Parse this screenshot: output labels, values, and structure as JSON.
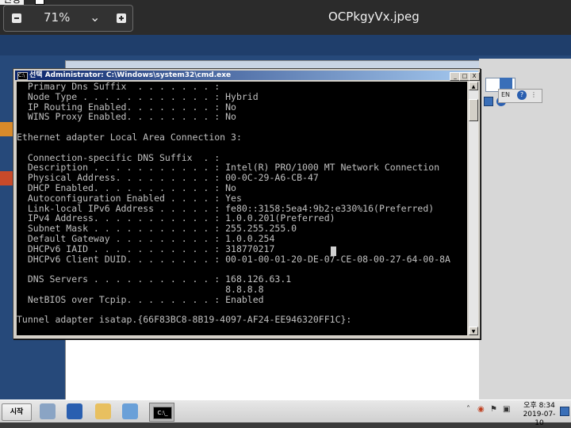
{
  "viewer": {
    "corner_label": "신청",
    "zoom": "71%",
    "filename": "OCPkgyVx.jpeg"
  },
  "cmd": {
    "title": "선택 Administrator: C:\\Windows\\system32\\cmd.exe",
    "minimize": "_",
    "maximize": "□",
    "close": "X",
    "lines": [
      "  Primary Dns Suffix  . . . . . . . :",
      "  Node Type . . . . . . . . . . . . : Hybrid",
      "  IP Routing Enabled. . . . . . . . : No",
      "  WINS Proxy Enabled. . . . . . . . : No",
      "",
      "Ethernet adapter Local Area Connection 3:",
      "",
      "  Connection-specific DNS Suffix  . :",
      "  Description . . . . . . . . . . . : Intel(R) PRO/1000 MT Network Connection",
      "  Physical Address. . . . . . . . . : 00-0C-29-A6-CB-47",
      "  DHCP Enabled. . . . . . . . . . . : No",
      "  Autoconfiguration Enabled . . . . : Yes",
      "  Link-local IPv6 Address . . . . . : fe80::3158:5ea4:9b2:e330%16(Preferred)",
      "  IPv4 Address. . . . . . . . . . . : 1.0.0.201(Preferred)",
      "  Subnet Mask . . . . . . . . . . . : 255.255.255.0",
      "  Default Gateway . . . . . . . . . : 1.0.0.254",
      "  DHCPv6 IAID . . . . . . . . . . . : 318770217",
      "  DHCPv6 Client DUID. . . . . . . . : 00-01-00-01-20-DE-07-CE-08-00-27-64-00-8A",
      "",
      "  DNS Servers . . . . . . . . . . . : 168.126.63.1",
      "                                      8.8.8.8",
      "  NetBIOS over Tcpip. . . . . . . . : Enabled",
      "",
      "Tunnel adapter isatap.{66F83BC8-8B19-4097-AF24-EE946320FF1C}:"
    ]
  },
  "language_bar": {
    "lang": "EN",
    "help": "?"
  },
  "taskbar": {
    "start_label": "시작",
    "cmd_icon_text": "C:\\_",
    "clock_time": "오후 8:34",
    "clock_date": "2019-07-10"
  }
}
